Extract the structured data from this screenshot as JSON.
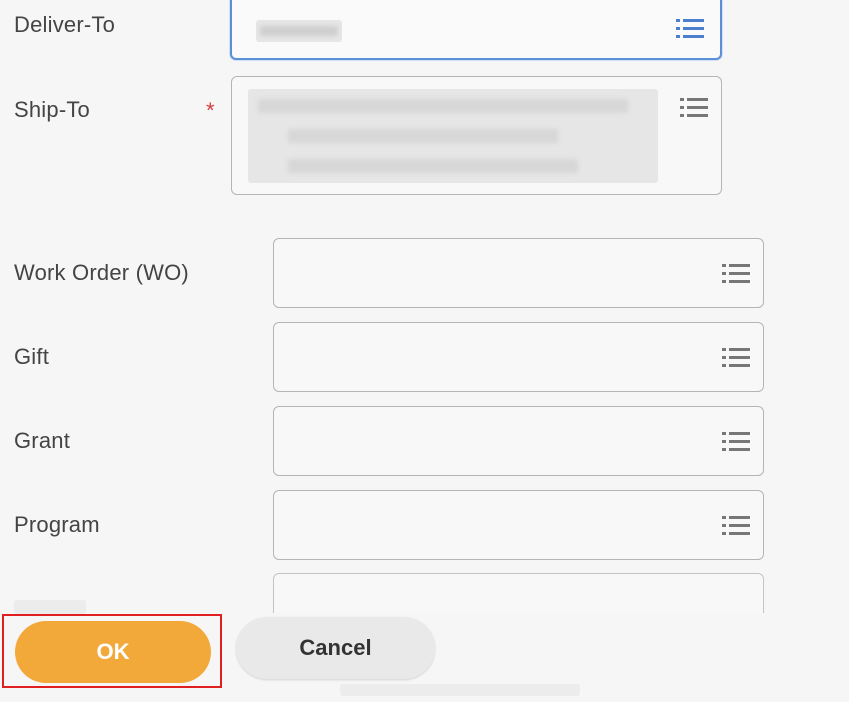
{
  "form": {
    "fields": [
      {
        "key": "deliver_to",
        "label": "Deliver-To",
        "value": "",
        "required": false,
        "focused": true
      },
      {
        "key": "ship_to",
        "label": "Ship-To",
        "value": "",
        "required": true,
        "required_marker": "*"
      },
      {
        "key": "work_order",
        "label": "Work Order (WO)",
        "value": ""
      },
      {
        "key": "gift",
        "label": "Gift",
        "value": ""
      },
      {
        "key": "grant",
        "label": "Grant",
        "value": ""
      },
      {
        "key": "program",
        "label": "Program",
        "value": ""
      }
    ],
    "prompt_icon": "list-prompt-icon"
  },
  "actions": {
    "ok_label": "OK",
    "cancel_label": "Cancel"
  },
  "colors": {
    "ok_button": "#f3a93a",
    "cancel_button": "#e9e9e9",
    "focus_border": "#5b8fd6",
    "required_star": "#d63c3c",
    "highlight_frame": "#e02020"
  }
}
